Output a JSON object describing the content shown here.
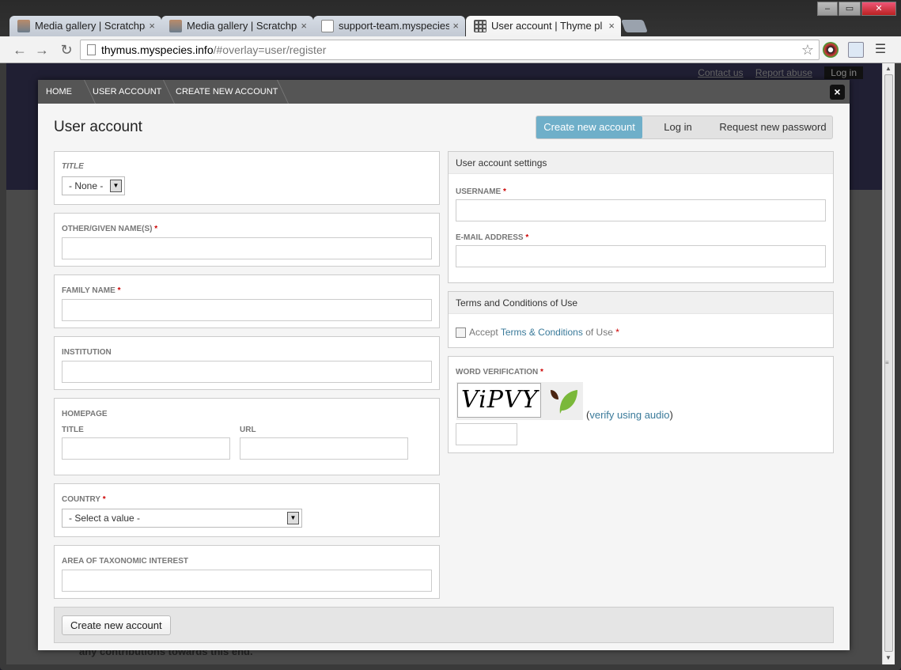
{
  "browser": {
    "tabs": [
      {
        "title": "Media gallery | Scratchpad",
        "icon": "person-favicon"
      },
      {
        "title": "Media gallery | Scratchpad",
        "icon": "person-favicon"
      },
      {
        "title": "support-team.myspecies.i",
        "icon": "page-favicon"
      },
      {
        "title": "User account | Thyme plant",
        "icon": "grid-favicon"
      }
    ],
    "tab_close": "×",
    "url_host": "thymus.myspecies.info",
    "url_path": "/#overlay=user/register",
    "window_controls": [
      "–",
      "▭",
      "✕"
    ]
  },
  "page": {
    "top_links": [
      "Contact us",
      "Report abuse"
    ],
    "login_link": "Log in",
    "background_text": "any contributions towards this end."
  },
  "overlay": {
    "breadcrumbs": [
      "HOME",
      "USER ACCOUNT",
      "CREATE NEW ACCOUNT"
    ],
    "close": "×",
    "title": "User account",
    "tabs": [
      "Create new account",
      "Log in",
      "Request new password"
    ],
    "active_tab": "Create new account",
    "form": {
      "title_label": "TITLE",
      "title_value": "- None -",
      "given_name_label": "OTHER/GIVEN NAME(S)",
      "family_name_label": "FAMILY NAME",
      "institution_label": "INSTITUTION",
      "homepage_label": "HOMEPAGE",
      "homepage_title_label": "TITLE",
      "homepage_url_label": "URL",
      "country_label": "COUNTRY",
      "country_value": "- Select a value -",
      "taxonomic_label": "AREA OF TAXONOMIC INTEREST",
      "required_mark": "*"
    },
    "settings": {
      "heading": "User account settings",
      "username_label": "USERNAME",
      "email_label": "E-MAIL ADDRESS"
    },
    "terms": {
      "heading": "Terms and Conditions of Use",
      "accept_prefix": "Accept",
      "accept_link": "Terms & Conditions",
      "accept_suffix": "of Use",
      "checked": false
    },
    "verification": {
      "label": "WORD VERIFICATION",
      "captcha_text": "ViPVY",
      "audio_open": "(",
      "audio_link": "verify using audio",
      "audio_close": ")"
    },
    "submit_label": "Create new account"
  },
  "colors": {
    "accent_tab": "#6fafc9",
    "link": "#3a7a9a",
    "required": "#cc0000",
    "breadcrumb_bar": "#555555"
  }
}
